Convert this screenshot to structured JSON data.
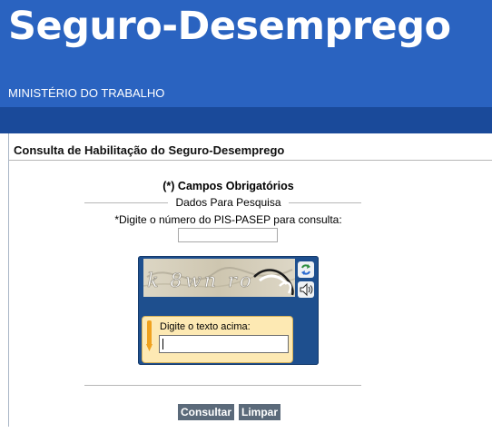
{
  "header": {
    "brand": "Seguro-Desemprego",
    "ministry": "MINISTÉRIO DO TRABALHO"
  },
  "page": {
    "title": "Consulta de Habilitação do Seguro-Desemprego"
  },
  "form": {
    "required_note": "(*) Campos Obrigatórios",
    "legend": "Dados Para Pesquisa",
    "pis_label": "*Digite o número do PIS-PASEP para consulta:",
    "pis_value": ""
  },
  "captcha": {
    "image_text": "k 8wn ro",
    "entry_label": "Digite o texto acima:",
    "entry_value": "",
    "icons": [
      "refresh-icon",
      "audio-icon"
    ]
  },
  "buttons": {
    "consultar": "Consultar",
    "limpar": "Limpar"
  },
  "colors": {
    "header_blue": "#2a63c0",
    "navbar_blue": "#1a4a9a",
    "button_gray": "#5b6a7a",
    "captcha_frame": "#1e4f8e",
    "captcha_entry_bg": "#fde9b3"
  }
}
